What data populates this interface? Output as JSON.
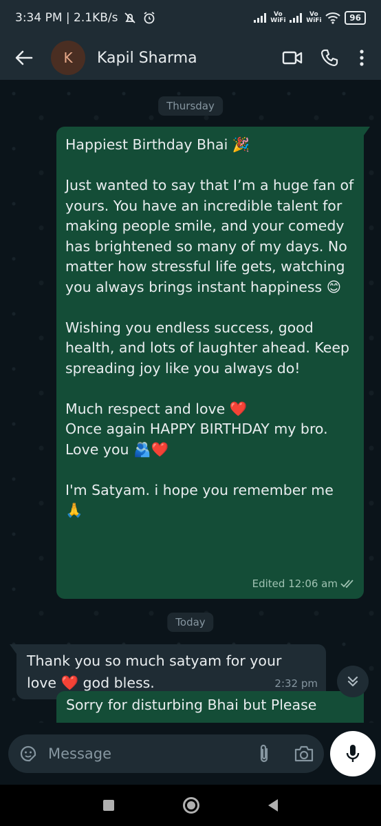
{
  "status_bar": {
    "time_speed": "3:34 PM | 2.1KB/s",
    "sim1_label": "Vo WiFi",
    "sim2_label": "Vo WiFi",
    "battery": "96"
  },
  "header": {
    "avatar_letter": "K",
    "contact_name": "Kapil Sharma"
  },
  "chat": {
    "date_1": "Thursday",
    "message_out": {
      "paragraphs": [
        [
          "Happiest Birthday Bhai 🎉"
        ],
        [
          "Just wanted to say that I’m a huge fan of yours. You have an incredible talent for making people smile, and your comedy has brightened so many of my days. No matter how stressful life gets, watching you always brings instant happiness 😊"
        ],
        [
          "Wishing you endless success, good health, and lots of laughter ahead. Keep spreading joy like you always do!"
        ],
        [
          "Much respect and love ❤️",
          "Once again HAPPY BIRTHDAY my bro.",
          "Love you 🫂❤️"
        ],
        [
          "I'm Satyam. i hope you remember me 🙏"
        ]
      ],
      "meta": "Edited 12:06 am"
    },
    "date_2": "Today",
    "message_in": {
      "text": "Thank you so much satyam for your love ❤️ god bless.",
      "time": "2:32 pm"
    },
    "partial_message": "Sorry for disturbing Bhai but Please"
  },
  "composer": {
    "placeholder": "Message"
  },
  "colors": {
    "outgoing_bubble": "#144d37",
    "incoming_bubble": "#1f2c34",
    "background": "#0b141a",
    "read_ticks": "#9fc2b2"
  }
}
